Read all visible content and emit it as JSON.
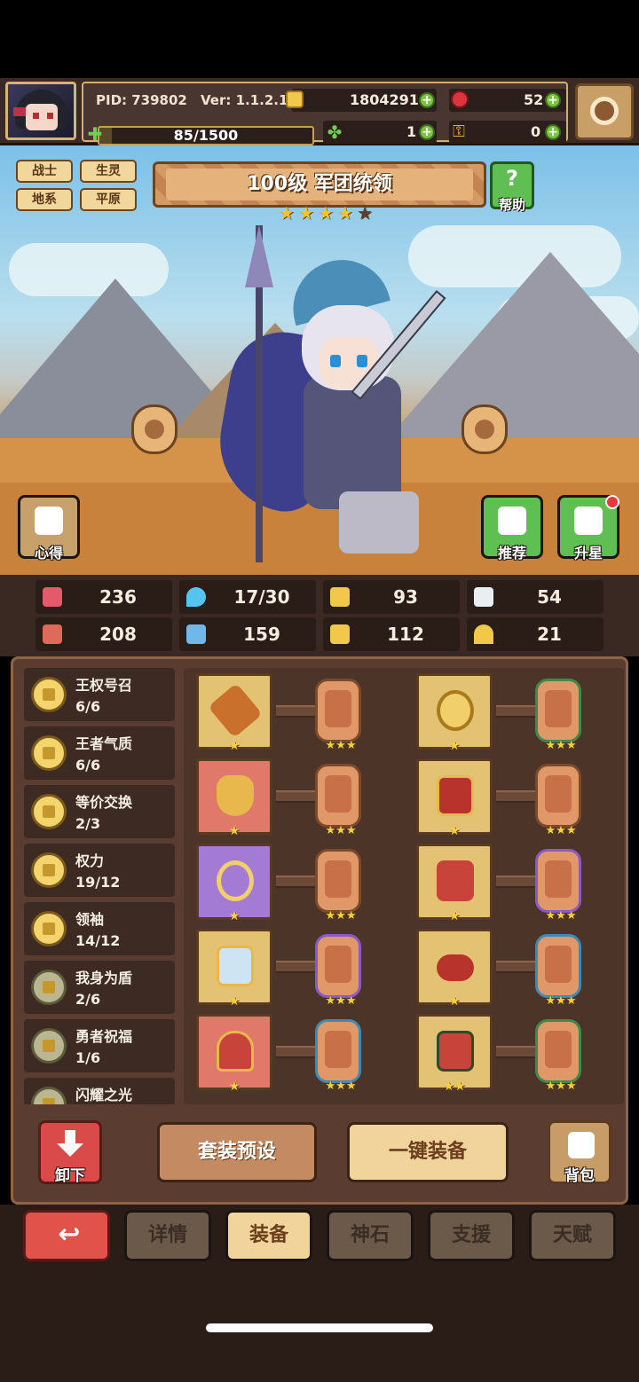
{
  "header": {
    "pid": "PID: 739802",
    "version": "Ver: 1.1.2.1",
    "gold": "1804291",
    "rubies": "52",
    "energy": "85/1500",
    "clovers": "1",
    "keys": "0"
  },
  "hero": {
    "tags": [
      "战士",
      "生灵",
      "地系",
      "平原"
    ],
    "title": "100级 军团统领",
    "stars_filled": 4,
    "stars_total": 5,
    "help_label": "帮助",
    "notes_label": "心得",
    "recommend_label": "推荐",
    "upgrade_star_label": "升星"
  },
  "stats": [
    {
      "icon": "heart-icon",
      "value": "236",
      "color": "#e45a6a"
    },
    {
      "icon": "water-drop-icon",
      "value": "17/30",
      "color": "#56c4f0"
    },
    {
      "icon": "shield-icon",
      "value": "93",
      "color": "#f2c84b"
    },
    {
      "icon": "wing-icon",
      "value": "54",
      "color": "#e9eef2"
    },
    {
      "icon": "fist-icon",
      "value": "208",
      "color": "#e06a5a"
    },
    {
      "icon": "book-icon",
      "value": "159",
      "color": "#6fb8e8"
    },
    {
      "icon": "speed-boot-icon",
      "value": "112",
      "color": "#f2c84b"
    },
    {
      "icon": "horseshoe-icon",
      "value": "21",
      "color": "#f2c84b"
    }
  ],
  "sets": [
    {
      "name": "王权号召",
      "count": "6/6"
    },
    {
      "name": "王者气质",
      "count": "6/6"
    },
    {
      "name": "等价交换",
      "count": "2/3"
    },
    {
      "name": "权力",
      "count": "19/12"
    },
    {
      "name": "领袖",
      "count": "14/12"
    },
    {
      "name": "我身为盾",
      "count": "2/6"
    },
    {
      "name": "勇者祝福",
      "count": "1/6"
    },
    {
      "name": "闪耀之光",
      "count": ""
    }
  ],
  "equipment": {
    "slot_stars_one": "★",
    "slot_stars_two": "★★",
    "gem_stars": "★★★"
  },
  "actions": {
    "unequip_label": "卸下",
    "preset_label": "套装预设",
    "auto_equip_label": "一键装备",
    "bag_label": "背包"
  },
  "tabs": {
    "details": "详情",
    "equipment": "装备",
    "godstone": "神石",
    "support": "支援",
    "talent": "天赋"
  }
}
